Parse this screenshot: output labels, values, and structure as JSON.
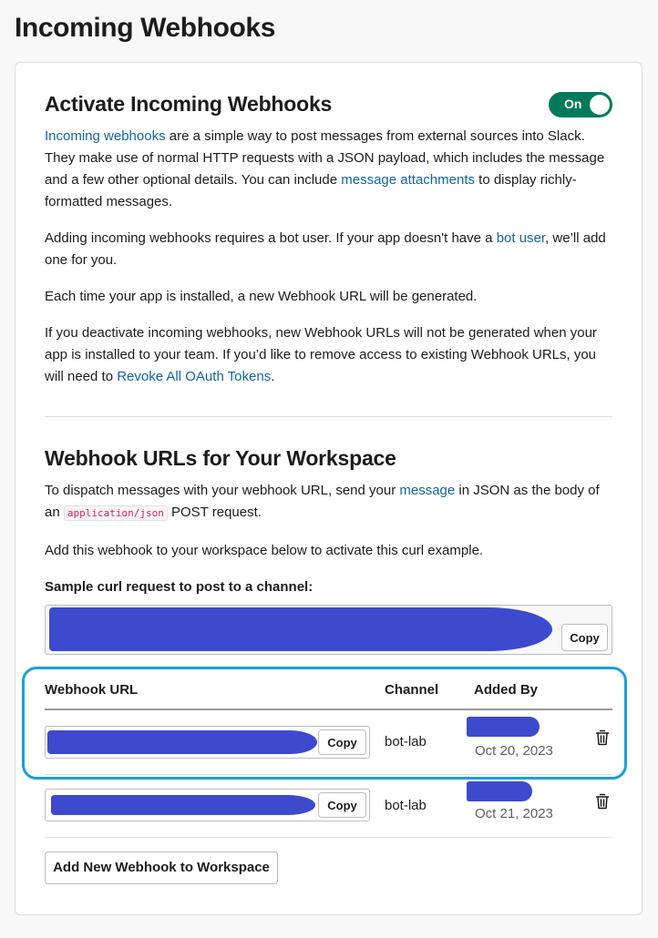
{
  "page": {
    "title": "Incoming Webhooks"
  },
  "activate": {
    "title": "Activate Incoming Webhooks",
    "toggle_label": "On",
    "p1_link1": "Incoming webhooks",
    "p1_text1": " are a simple way to post messages from external sources into Slack. They make use of normal HTTP requests with a JSON payload, which includes the message and a few other optional details. You can include ",
    "p1_link2": "message attachments",
    "p1_text2": " to display richly-formatted messages.",
    "p2_text1": "Adding incoming webhooks requires a bot user. If your app doesn't have a ",
    "p2_link": "bot user",
    "p2_text2": ", we’ll add one for you.",
    "p3_text": "Each time your app is installed, a new Webhook URL will be generated.",
    "p4_text1": "If you deactivate incoming webhooks, new Webhook URLs will not be generated when your app is installed to your team. If you’d like to remove access to existing Webhook URLs, you will need to ",
    "p4_link": "Revoke All OAuth Tokens",
    "p4_text2": "."
  },
  "webhooks": {
    "title": "Webhook URLs for Your Workspace",
    "p1_text1": "To dispatch messages with your webhook URL, send your ",
    "p1_link": "message",
    "p1_text2": " in JSON as the body of an ",
    "p1_code": "application/json",
    "p1_text3": " POST request.",
    "p2_text": "Add this webhook to your workspace below to activate this curl example.",
    "sample_label": "Sample curl request to post to a channel:",
    "copy_label": "Copy",
    "columns": {
      "url": "Webhook URL",
      "channel": "Channel",
      "added_by": "Added By"
    },
    "rows": [
      {
        "channel": "bot-lab",
        "date": "Oct 20, 2023"
      },
      {
        "channel": "bot-lab",
        "date": "Oct 21, 2023"
      }
    ],
    "add_button": "Add New Webhook to Workspace"
  },
  "colors": {
    "toggle_on": "#007a5a",
    "link": "#1264a3",
    "redaction": "#3c4ace",
    "highlight": "#1aa0dc"
  },
  "icons": {
    "delete": "trash-icon"
  }
}
